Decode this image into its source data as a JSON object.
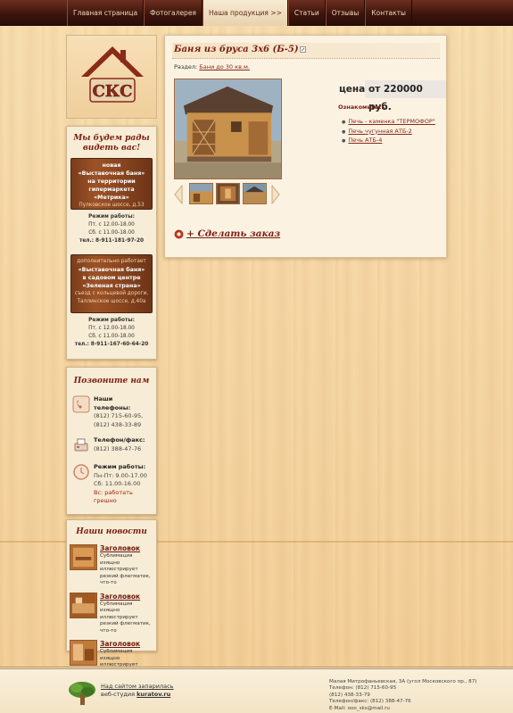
{
  "nav": {
    "items": [
      {
        "label": "Главная страница",
        "active": false
      },
      {
        "label": "Фотогалерея",
        "active": false
      },
      {
        "label": "Наша продукция >>",
        "active": true
      },
      {
        "label": "Статьи",
        "active": false
      },
      {
        "label": "Отзывы",
        "active": false
      },
      {
        "label": "Контакты",
        "active": false
      }
    ]
  },
  "logo": {
    "text": "СКС"
  },
  "welcome": {
    "title": "Мы будем рады видеть вас!",
    "stores": [
      {
        "line1": "новая",
        "line2": "«Выставочная баня»",
        "line3": "на территории",
        "line4": "гипермаркета «Метрика»",
        "address": "Пулковское шоссе, д.53",
        "hours_title": "Режим работы:",
        "hours1": "Пт. с 12.00-18.00",
        "hours2": "Сб. с 11.00-18.00",
        "phone": "тел.: 8-911-181-97-20"
      },
      {
        "line0": "дополнительно работает",
        "line2": "«Выставочная баня»",
        "line3": "в садовом центре",
        "line4": "«Зеленая страна»",
        "address1": "съезд с кольцевой дороги,",
        "address2": "Таллинское шоссе, д.40а",
        "hours_title": "Режим работы:",
        "hours1": "Пт. с 12.00-18.00",
        "hours2": "Сб. с 11.00-18.00",
        "phone": "тел.: 8-911-167-60-64-20"
      }
    ]
  },
  "call": {
    "title": "Позвоните нам",
    "phones_title": "Наши телефоны:",
    "phone1": "(812) 715-60-95,",
    "phone2": "(812) 438-33-89",
    "fax_title": "Телефон/факс:",
    "fax": "(812) 388-47-76",
    "hours_title": "Режим работы:",
    "hours1": "Пн-Пт: 9.00-17.00",
    "hours2": "Сб: 11.00-16.00",
    "hours3": "Вс: работать грешно"
  },
  "news": {
    "title": "Наши новости",
    "items": [
      {
        "title": "Заголовок",
        "text": "Сублимация изящно иллюстрирует резкий флегматик, что-то"
      },
      {
        "title": "Заголовок",
        "text": "Сублимация изящно иллюстрирует резкий флегматик, что-то"
      },
      {
        "title": "Заголовок",
        "text": "Сублимация изящно иллюстрирует резкий флегматик, что-то"
      }
    ]
  },
  "product": {
    "title": "Баня из бруса 3х6 (Б-5)",
    "section_label": "Раздел:",
    "section_link": "Бани до 30 кв.м.",
    "price_label": "цена:",
    "price": "от 220000 руб.",
    "see_also": "Ознакомьтесь",
    "links": [
      "Печь - каменка \"ТЕРМОФОР\"",
      "Печь чугунная АТБ-2",
      "Печь АТБ-4"
    ],
    "order": "+ Сделать заказ"
  },
  "footer": {
    "site_line": "Над сайтом запарилась",
    "studio_prefix": "веб-студия",
    "studio": "kuratov.ru",
    "address": "Малая Митрофаньевская, 3А (угол Московского пр., 87)",
    "phone_line": "Телефон: (812) 715-60-95",
    "phone_line2": "(812) 438-33-79",
    "fax_line": "Телефон/факс: (812) 388-47-76",
    "email_line": "E-Mail: ooo_sks@mail.ru"
  },
  "colors": {
    "accent": "#7a1e12",
    "nav_bg": "#3a140c",
    "wood": "#f5d7a4"
  }
}
